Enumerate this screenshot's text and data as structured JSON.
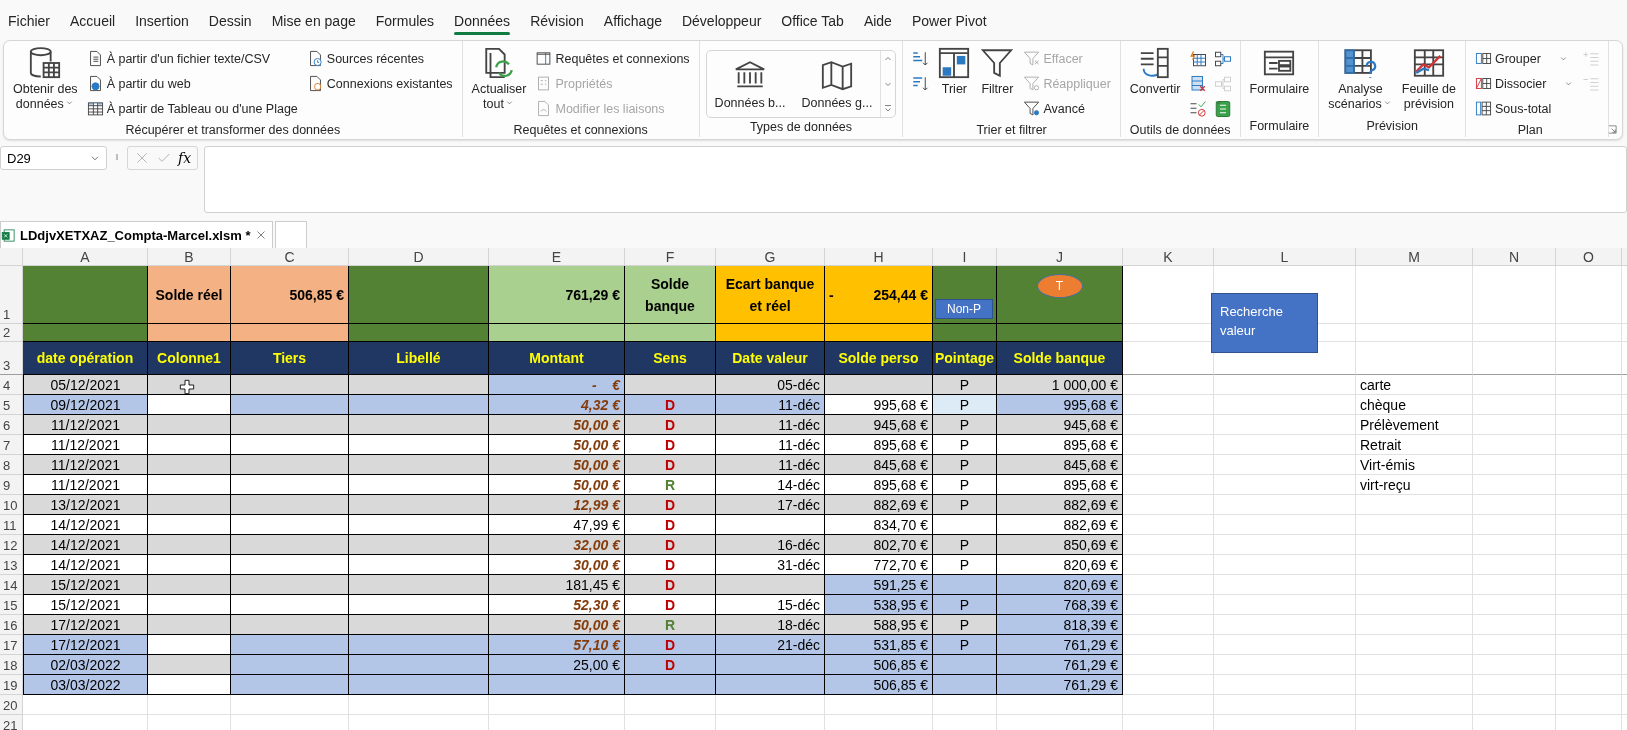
{
  "menu_tabs": [
    {
      "label": "Fichier",
      "selected": false
    },
    {
      "label": "Accueil",
      "selected": false
    },
    {
      "label": "Insertion",
      "selected": false
    },
    {
      "label": "Dessin",
      "selected": false
    },
    {
      "label": "Mise en page",
      "selected": false
    },
    {
      "label": "Formules",
      "selected": false
    },
    {
      "label": "Données",
      "selected": true
    },
    {
      "label": "Révision",
      "selected": false
    },
    {
      "label": "Affichage",
      "selected": false
    },
    {
      "label": "Développeur",
      "selected": false
    },
    {
      "label": "Office Tab",
      "selected": false
    },
    {
      "label": "Aide",
      "selected": false
    },
    {
      "label": "Power Pivot",
      "selected": false
    }
  ],
  "ribbon": {
    "groups": [
      {
        "label": "Récupérer et transformer des données",
        "columns": [
          [
            {
              "kind": "large",
              "label": "Obtenir des\ndonnées",
              "caret": true
            }
          ],
          [
            {
              "kind": "small",
              "label": "À partir d'un fichier texte/CSV"
            },
            {
              "kind": "small",
              "label": "À partir du web"
            },
            {
              "kind": "small",
              "label": "À partir de Tableau ou d'une Plage"
            }
          ],
          [
            {
              "kind": "small",
              "label": "Sources récentes"
            },
            {
              "kind": "small",
              "label": "Connexions existantes"
            }
          ]
        ]
      },
      {
        "label": "Requêtes et connexions",
        "columns": [
          [
            {
              "kind": "large",
              "label": "Actualiser\ntout",
              "caret": true
            }
          ],
          [
            {
              "kind": "small",
              "label": "Requêtes et connexions",
              "disabled": false
            },
            {
              "kind": "small",
              "label": "Propriétés",
              "disabled": true
            },
            {
              "kind": "small",
              "label": "Modifier les liaisons",
              "disabled": true
            }
          ]
        ]
      },
      {
        "label": "Types de données",
        "columns": [
          [
            {
              "kind": "tile",
              "label": "Données b..."
            },
            {
              "kind": "tile",
              "label": "Données g..."
            }
          ]
        ]
      },
      {
        "label": "Trier et filtrer",
        "columns": [
          [
            {
              "kind": "icon"
            },
            {
              "kind": "icon"
            }
          ],
          [
            {
              "kind": "large",
              "label": "Trier"
            }
          ],
          [
            {
              "kind": "large",
              "label": "Filtrer"
            }
          ],
          [
            {
              "kind": "small",
              "label": "Effacer",
              "disabled": true
            },
            {
              "kind": "small",
              "label": "Réappliquer",
              "disabled": true
            },
            {
              "kind": "small",
              "label": "Avancé",
              "disabled": false
            }
          ]
        ]
      },
      {
        "label": "Outils de données",
        "columns": [
          [
            {
              "kind": "large",
              "label": "Convertir"
            }
          ],
          [
            {
              "kind": "icon"
            },
            {
              "kind": "icon"
            },
            {
              "kind": "icon",
              "caret": true
            }
          ],
          [
            {
              "kind": "icon",
              "disabled": false
            },
            {
              "kind": "icon",
              "disabled": true
            },
            {
              "kind": "icon",
              "disabled": false
            }
          ]
        ]
      },
      {
        "label": "Formulaire",
        "columns": [
          [
            {
              "kind": "large",
              "label": "Formulaire"
            }
          ]
        ]
      },
      {
        "label": "Prévision",
        "columns": [
          [
            {
              "kind": "large",
              "label": "Analyse\nscénarios",
              "caret": true
            }
          ],
          [
            {
              "kind": "large",
              "label": "Feuille de\nprévision"
            }
          ]
        ]
      },
      {
        "label": "Plan",
        "columns": [
          [
            {
              "kind": "small",
              "label": "Grouper",
              "caret": true
            },
            {
              "kind": "small",
              "label": "Dissocier",
              "caret": true
            },
            {
              "kind": "small",
              "label": "Sous-total"
            }
          ],
          [
            {
              "kind": "icon",
              "disabled": true
            },
            {
              "kind": "icon",
              "disabled": true
            }
          ]
        ]
      }
    ]
  },
  "formula_bar": {
    "name_box": "D29",
    "fx": "fx"
  },
  "workbook_tabs": [
    {
      "label": "LDdjvXETXAZ_Compta-Marcel.xlsm *",
      "selected": true
    }
  ],
  "sheet": {
    "columns": [
      "A",
      "B",
      "C",
      "D",
      "E",
      "F",
      "G",
      "H",
      "I",
      "J",
      "K",
      "L",
      "M",
      "N",
      "O"
    ],
    "row_numbers": [
      "1",
      "2",
      "3",
      "4",
      "5",
      "6",
      "7",
      "8",
      "9",
      "10",
      "11",
      "12",
      "13",
      "14",
      "15",
      "16",
      "17",
      "18",
      "19",
      "20",
      "21"
    ],
    "summary_row": [
      {
        "kind": "empty",
        "color": "#548235"
      },
      {
        "kind": "label",
        "text": "Solde réel",
        "color": "#f4b183"
      },
      {
        "kind": "amount",
        "text": "506,85 €",
        "color": "#f4b183"
      },
      {
        "kind": "empty",
        "color": "#548235"
      },
      {
        "kind": "amount",
        "text": "761,29 €",
        "color": "#a9d08e"
      },
      {
        "kind": "label",
        "text": "Solde banque",
        "color": "#a9d08e"
      },
      {
        "kind": "label",
        "text": "Ecart banque et réel",
        "color": "#ffc000"
      },
      {
        "kind": "signed",
        "sign": "-",
        "text": "254,44 €",
        "color": "#ffc000"
      },
      {
        "kind": "button",
        "text": "Non-P",
        "color": "#548235"
      },
      {
        "kind": "oval",
        "text": "T",
        "color": "#548235"
      }
    ],
    "headers": [
      "date opération",
      "Colonne1",
      "Tiers",
      "Libellé",
      "Montant",
      "Sens",
      "Date valeur",
      "Solde perso",
      "Pointage",
      "Solde banque"
    ],
    "rows": [
      {
        "cells": [
          {
            "text": "05/12/2021",
            "color": "#d9d9d9"
          },
          {
            "color": "#d9d9d9"
          },
          {
            "color": "#d9d9d9"
          },
          {
            "color": "#d9d9d9"
          },
          {
            "text": "-    €",
            "color": "#b4c6e7"
          },
          {
            "color": "#d9d9d9"
          },
          {
            "text": "05-déc",
            "color": "#d9d9d9"
          },
          {
            "color": "#d9d9d9"
          },
          {
            "text": "P",
            "color": "#d9d9d9"
          },
          {
            "text": "1 000,00 €",
            "color": "#d9d9d9"
          }
        ],
        "emphasized": true
      },
      {
        "cells": [
          {
            "text": "09/12/2021",
            "color": "#b4c6e7"
          },
          {
            "color": "#ffffff"
          },
          {
            "color": "#b4c6e7"
          },
          {
            "color": "#b4c6e7"
          },
          {
            "text": "4,32 €",
            "color": "#b4c6e7"
          },
          {
            "text": "D",
            "color": "#b4c6e7"
          },
          {
            "text": "11-déc",
            "color": "#b4c6e7"
          },
          {
            "text": "995,68 €",
            "color": "#ffffff"
          },
          {
            "text": "P",
            "color": "#ddebf7"
          },
          {
            "text": "995,68 €",
            "color": "#b4c6e7"
          }
        ],
        "emphasized": true,
        "kind": "debit"
      },
      {
        "cells": [
          {
            "text": "11/12/2021",
            "color": "#d9d9d9"
          },
          {
            "color": "#d9d9d9"
          },
          {
            "color": "#d9d9d9"
          },
          {
            "color": "#d9d9d9"
          },
          {
            "text": "50,00 €",
            "color": "#d9d9d9"
          },
          {
            "text": "D",
            "color": "#d9d9d9"
          },
          {
            "text": "11-déc",
            "color": "#d9d9d9"
          },
          {
            "text": "945,68 €",
            "color": "#d9d9d9"
          },
          {
            "text": "P",
            "color": "#d9d9d9"
          },
          {
            "text": "945,68 €",
            "color": "#d9d9d9"
          }
        ],
        "emphasized": true,
        "kind": "debit"
      },
      {
        "cells": [
          {
            "text": "11/12/2021",
            "color": "#ffffff"
          },
          {
            "color": "#ffffff"
          },
          {
            "color": "#ffffff"
          },
          {
            "color": "#ffffff"
          },
          {
            "text": "50,00 €",
            "color": "#ffffff"
          },
          {
            "text": "D",
            "color": "#ffffff"
          },
          {
            "text": "11-déc",
            "color": "#ffffff"
          },
          {
            "text": "895,68 €",
            "color": "#ffffff"
          },
          {
            "text": "P",
            "color": "#ffffff"
          },
          {
            "text": "895,68 €",
            "color": "#ffffff"
          }
        ],
        "emphasized": true,
        "kind": "debit"
      },
      {
        "cells": [
          {
            "text": "11/12/2021",
            "color": "#d9d9d9"
          },
          {
            "color": "#d9d9d9"
          },
          {
            "color": "#d9d9d9"
          },
          {
            "color": "#d9d9d9"
          },
          {
            "text": "50,00 €",
            "color": "#d9d9d9"
          },
          {
            "text": "D",
            "color": "#d9d9d9"
          },
          {
            "text": "11-déc",
            "color": "#d9d9d9"
          },
          {
            "text": "845,68 €",
            "color": "#d9d9d9"
          },
          {
            "text": "P",
            "color": "#d9d9d9"
          },
          {
            "text": "845,68 €",
            "color": "#d9d9d9"
          }
        ],
        "emphasized": true,
        "kind": "debit"
      },
      {
        "cells": [
          {
            "text": "11/12/2021",
            "color": "#ffffff"
          },
          {
            "color": "#ffffff"
          },
          {
            "color": "#ffffff"
          },
          {
            "color": "#ffffff"
          },
          {
            "text": "50,00 €",
            "color": "#ffffff"
          },
          {
            "text": "R",
            "color": "#ffffff"
          },
          {
            "text": "14-déc",
            "color": "#ffffff"
          },
          {
            "text": "895,68 €",
            "color": "#ffffff"
          },
          {
            "text": "P",
            "color": "#ffffff"
          },
          {
            "text": "895,68 €",
            "color": "#ffffff"
          }
        ],
        "emphasized": true,
        "kind": "credit"
      },
      {
        "cells": [
          {
            "text": "13/12/2021",
            "color": "#d9d9d9"
          },
          {
            "color": "#d9d9d9"
          },
          {
            "color": "#d9d9d9"
          },
          {
            "color": "#d9d9d9"
          },
          {
            "text": "12,99 €",
            "color": "#d9d9d9"
          },
          {
            "text": "D",
            "color": "#d9d9d9"
          },
          {
            "text": "17-déc",
            "color": "#d9d9d9"
          },
          {
            "text": "882,69 €",
            "color": "#d9d9d9"
          },
          {
            "text": "P",
            "color": "#d9d9d9"
          },
          {
            "text": "882,69 €",
            "color": "#d9d9d9"
          }
        ],
        "emphasized": true,
        "kind": "debit"
      },
      {
        "cells": [
          {
            "text": "14/12/2021",
            "color": "#ffffff"
          },
          {
            "color": "#ffffff"
          },
          {
            "color": "#ffffff"
          },
          {
            "color": "#ffffff"
          },
          {
            "text": "47,99 €",
            "color": "#ffffff"
          },
          {
            "text": "D",
            "color": "#ffffff"
          },
          {
            "color": "#ffffff"
          },
          {
            "text": "834,70 €",
            "color": "#ffffff"
          },
          {
            "color": "#ffffff"
          },
          {
            "text": "882,69 €",
            "color": "#ffffff"
          }
        ],
        "emphasized": false,
        "kind": "debit"
      },
      {
        "cells": [
          {
            "text": "14/12/2021",
            "color": "#d9d9d9"
          },
          {
            "color": "#d9d9d9"
          },
          {
            "color": "#d9d9d9"
          },
          {
            "color": "#d9d9d9"
          },
          {
            "text": "32,00 €",
            "color": "#d9d9d9"
          },
          {
            "text": "D",
            "color": "#d9d9d9"
          },
          {
            "text": "16-déc",
            "color": "#d9d9d9"
          },
          {
            "text": "802,70 €",
            "color": "#d9d9d9"
          },
          {
            "text": "P",
            "color": "#d9d9d9"
          },
          {
            "text": "850,69 €",
            "color": "#d9d9d9"
          }
        ],
        "emphasized": true,
        "kind": "debit"
      },
      {
        "cells": [
          {
            "text": "14/12/2021",
            "color": "#ffffff"
          },
          {
            "color": "#ffffff"
          },
          {
            "color": "#ffffff"
          },
          {
            "color": "#ffffff"
          },
          {
            "text": "30,00 €",
            "color": "#ffffff"
          },
          {
            "text": "D",
            "color": "#ffffff"
          },
          {
            "text": "31-déc",
            "color": "#ffffff"
          },
          {
            "text": "772,70 €",
            "color": "#ffffff"
          },
          {
            "text": "P",
            "color": "#ffffff"
          },
          {
            "text": "820,69 €",
            "color": "#ffffff"
          }
        ],
        "emphasized": true,
        "kind": "debit"
      },
      {
        "cells": [
          {
            "text": "15/12/2021",
            "color": "#d9d9d9"
          },
          {
            "color": "#d9d9d9"
          },
          {
            "color": "#d9d9d9"
          },
          {
            "color": "#d9d9d9"
          },
          {
            "text": "181,45 €",
            "color": "#d9d9d9"
          },
          {
            "text": "D",
            "color": "#d9d9d9"
          },
          {
            "color": "#d9d9d9"
          },
          {
            "text": "591,25 €",
            "color": "#b4c6e7"
          },
          {
            "color": "#b4c6e7"
          },
          {
            "text": "820,69 €",
            "color": "#b4c6e7"
          }
        ],
        "emphasized": false,
        "kind": "debit"
      },
      {
        "cells": [
          {
            "text": "15/12/2021",
            "color": "#ffffff"
          },
          {
            "color": "#ffffff"
          },
          {
            "color": "#ffffff"
          },
          {
            "color": "#ffffff"
          },
          {
            "text": "52,30 €",
            "color": "#ffffff"
          },
          {
            "text": "D",
            "color": "#ffffff"
          },
          {
            "text": "15-déc",
            "color": "#ffffff"
          },
          {
            "text": "538,95 €",
            "color": "#b4c6e7"
          },
          {
            "text": "P",
            "color": "#b4c6e7"
          },
          {
            "text": "768,39 €",
            "color": "#b4c6e7"
          }
        ],
        "emphasized": true,
        "kind": "debit"
      },
      {
        "cells": [
          {
            "text": "17/12/2021",
            "color": "#d9d9d9"
          },
          {
            "color": "#d9d9d9"
          },
          {
            "color": "#d9d9d9"
          },
          {
            "color": "#d9d9d9"
          },
          {
            "text": "50,00 €",
            "color": "#d9d9d9"
          },
          {
            "text": "R",
            "color": "#d9d9d9"
          },
          {
            "text": "18-déc",
            "color": "#d9d9d9"
          },
          {
            "text": "588,95 €",
            "color": "#d9d9d9"
          },
          {
            "text": "P",
            "color": "#d9d9d9"
          },
          {
            "text": "818,39 €",
            "color": "#b4c6e7"
          }
        ],
        "emphasized": true,
        "kind": "credit"
      },
      {
        "cells": [
          {
            "text": "17/12/2021",
            "color": "#b4c6e7"
          },
          {
            "color": "#ffffff"
          },
          {
            "color": "#b4c6e7"
          },
          {
            "color": "#b4c6e7"
          },
          {
            "text": "57,10 €",
            "color": "#b4c6e7"
          },
          {
            "text": "D",
            "color": "#b4c6e7"
          },
          {
            "text": "21-déc",
            "color": "#b4c6e7"
          },
          {
            "text": "531,85 €",
            "color": "#b4c6e7"
          },
          {
            "text": "P",
            "color": "#b4c6e7"
          },
          {
            "text": "761,29 €",
            "color": "#b4c6e7"
          }
        ],
        "emphasized": true,
        "kind": "debit"
      },
      {
        "cells": [
          {
            "text": "02/03/2022",
            "color": "#b4c6e7"
          },
          {
            "color": "#d9d9d9"
          },
          {
            "color": "#b4c6e7"
          },
          {
            "color": "#b4c6e7"
          },
          {
            "text": "25,00 €",
            "color": "#b4c6e7"
          },
          {
            "text": "D",
            "color": "#b4c6e7"
          },
          {
            "color": "#b4c6e7"
          },
          {
            "text": "506,85 €",
            "color": "#b4c6e7"
          },
          {
            "color": "#b4c6e7"
          },
          {
            "text": "761,29 €",
            "color": "#b4c6e7"
          }
        ],
        "emphasized": false,
        "kind": "debit"
      },
      {
        "cells": [
          {
            "text": "03/03/2022",
            "color": "#b4c6e7"
          },
          {
            "color": "#ffffff"
          },
          {
            "color": "#b4c6e7"
          },
          {
            "color": "#b4c6e7"
          },
          {
            "color": "#b4c6e7"
          },
          {
            "color": "#b4c6e7"
          },
          {
            "color": "#b4c6e7"
          },
          {
            "text": "506,85 €",
            "color": "#b4c6e7"
          },
          {
            "color": "#b4c6e7"
          },
          {
            "text": "761,29 €",
            "color": "#b4c6e7"
          }
        ]
      }
    ],
    "side_list": [
      "carte",
      "chèque",
      "Prélèvement",
      "Retrait",
      "Virt-émis",
      "virt-reçu"
    ],
    "floating_button": {
      "label": "Recherche valeur"
    }
  }
}
